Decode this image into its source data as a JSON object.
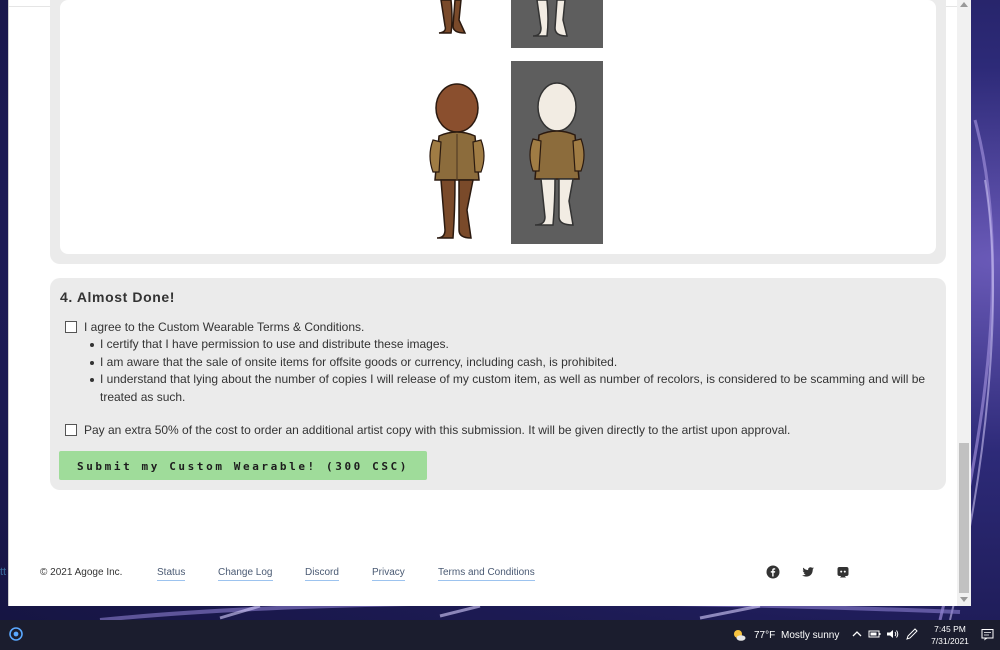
{
  "section": {
    "title": "4. Almost Done!",
    "agree_label": "I agree to the Custom Wearable Terms & Conditions.",
    "terms": [
      "I certify that I have permission to use and distribute these images.",
      "I am aware that the sale of onsite items for offsite goods or currency, including cash, is prohibited.",
      "I understand that lying about the number of copies I will release of my custom item, as well as number of recolors, is considered to be scamming and will be treated as such."
    ],
    "artist_copy_label": "Pay an extra 50% of the cost to order an additional artist copy with this submission. It will be given directly to the artist upon approval.",
    "submit_label": "Submit my Custom Wearable! (300 CSC)",
    "submit_color": "#9fdc9a"
  },
  "footer": {
    "copyright": "© 2021 Agoge Inc.",
    "links": [
      "Status",
      "Change Log",
      "Discord",
      "Privacy",
      "Terms and Conditions"
    ],
    "social_icons": [
      "facebook-icon",
      "twitter-icon",
      "discord-icon"
    ]
  },
  "taskbar": {
    "temperature": "77°F",
    "condition": "Mostly sunny",
    "time": "7:45 PM",
    "date": "7/31/2021"
  },
  "desktop": {
    "edge_glyph": "tt"
  }
}
